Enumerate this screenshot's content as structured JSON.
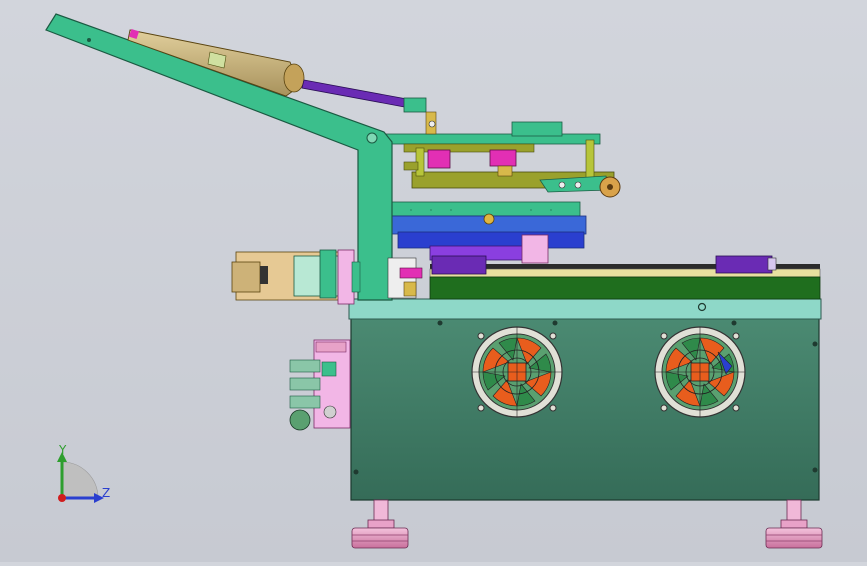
{
  "view": {
    "background": "#cdd0d7",
    "triad": {
      "y_label": "Y",
      "z_label": "Z",
      "y_color": "#2e9e2e",
      "z_color": "#2a3fcf",
      "origin_color": "#d01d1d"
    }
  },
  "colors": {
    "arm": "#3bbf8c",
    "cylinder": "#6a2bb4",
    "cabinet": "#3f7d66",
    "cabinet_top": "#8ed8c8",
    "conveyor": "#1f6e1e",
    "rail": "#2b2b2b",
    "fan_ring": "#e0e0d6",
    "fan_blade": "#e85d1d",
    "fan_blade_alt": "#2f8a4a",
    "plate_blue": "#2a3fcf",
    "plate_violet": "#8a3fe0",
    "magenta": "#e22fb4",
    "pink": "#f2b6e6",
    "olive": "#9aa12c",
    "tan": "#c9b07a",
    "feet": "#e8a2c8"
  },
  "components": {
    "fans": [
      "fan-left",
      "fan-right"
    ],
    "feet": [
      "foot-left",
      "foot-right"
    ]
  }
}
